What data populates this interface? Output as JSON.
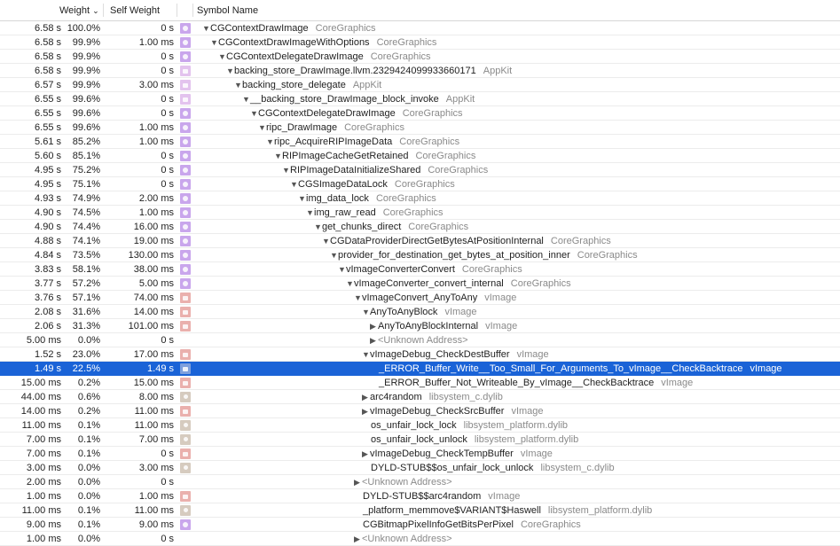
{
  "header": {
    "weight": "Weight",
    "self_weight": "Self Weight",
    "symbol_name": "Symbol Name",
    "sort_icon": "chevron-down-icon"
  },
  "colors": {
    "selection": "#1a63d7",
    "CoreGraphics": "#c9a6ec",
    "AppKit": "#e3c3ee",
    "vImage": "#eab0ad",
    "libsystem": "#d6cbbf"
  },
  "rows": [
    {
      "weight": "6.58 s",
      "percent": "100.0%",
      "self": "0 s",
      "icon": "cg",
      "level": 0,
      "disclosure": "open",
      "symbol": "CGContextDrawImage",
      "library": "CoreGraphics"
    },
    {
      "weight": "6.58 s",
      "percent": "99.9%",
      "self": "1.00 ms",
      "icon": "cg",
      "level": 1,
      "disclosure": "open",
      "symbol": "CGContextDrawImageWithOptions",
      "library": "CoreGraphics"
    },
    {
      "weight": "6.58 s",
      "percent": "99.9%",
      "self": "0 s",
      "icon": "cg",
      "level": 2,
      "disclosure": "open",
      "symbol": "CGContextDelegateDrawImage",
      "library": "CoreGraphics"
    },
    {
      "weight": "6.58 s",
      "percent": "99.9%",
      "self": "0 s",
      "icon": "ak",
      "level": 3,
      "disclosure": "open",
      "symbol": "backing_store_DrawImage.llvm.2329424099933660171",
      "library": "AppKit"
    },
    {
      "weight": "6.57 s",
      "percent": "99.9%",
      "self": "3.00 ms",
      "icon": "ak",
      "level": 4,
      "disclosure": "open",
      "symbol": "backing_store_delegate",
      "library": "AppKit"
    },
    {
      "weight": "6.55 s",
      "percent": "99.6%",
      "self": "0 s",
      "icon": "ak",
      "level": 5,
      "disclosure": "open",
      "symbol": "__backing_store_DrawImage_block_invoke",
      "library": "AppKit"
    },
    {
      "weight": "6.55 s",
      "percent": "99.6%",
      "self": "0 s",
      "icon": "cg",
      "level": 6,
      "disclosure": "open",
      "symbol": "CGContextDelegateDrawImage",
      "library": "CoreGraphics"
    },
    {
      "weight": "6.55 s",
      "percent": "99.6%",
      "self": "1.00 ms",
      "icon": "cg",
      "level": 7,
      "disclosure": "open",
      "symbol": "ripc_DrawImage",
      "library": "CoreGraphics"
    },
    {
      "weight": "5.61 s",
      "percent": "85.2%",
      "self": "1.00 ms",
      "icon": "cg",
      "level": 8,
      "disclosure": "open",
      "symbol": "ripc_AcquireRIPImageData",
      "library": "CoreGraphics"
    },
    {
      "weight": "5.60 s",
      "percent": "85.1%",
      "self": "0 s",
      "icon": "cg",
      "level": 9,
      "disclosure": "open",
      "symbol": "RIPImageCacheGetRetained",
      "library": "CoreGraphics"
    },
    {
      "weight": "4.95 s",
      "percent": "75.2%",
      "self": "0 s",
      "icon": "cg",
      "level": 10,
      "disclosure": "open",
      "symbol": "RIPImageDataInitializeShared",
      "library": "CoreGraphics"
    },
    {
      "weight": "4.95 s",
      "percent": "75.1%",
      "self": "0 s",
      "icon": "cg",
      "level": 11,
      "disclosure": "open",
      "symbol": "CGSImageDataLock",
      "library": "CoreGraphics"
    },
    {
      "weight": "4.93 s",
      "percent": "74.9%",
      "self": "2.00 ms",
      "icon": "cg",
      "level": 12,
      "disclosure": "open",
      "symbol": "img_data_lock",
      "library": "CoreGraphics"
    },
    {
      "weight": "4.90 s",
      "percent": "74.5%",
      "self": "1.00 ms",
      "icon": "cg",
      "level": 13,
      "disclosure": "open",
      "symbol": "img_raw_read",
      "library": "CoreGraphics"
    },
    {
      "weight": "4.90 s",
      "percent": "74.4%",
      "self": "16.00 ms",
      "icon": "cg",
      "level": 14,
      "disclosure": "open",
      "symbol": "get_chunks_direct",
      "library": "CoreGraphics"
    },
    {
      "weight": "4.88 s",
      "percent": "74.1%",
      "self": "19.00 ms",
      "icon": "cg",
      "level": 15,
      "disclosure": "open",
      "symbol": "CGDataProviderDirectGetBytesAtPositionInternal",
      "library": "CoreGraphics"
    },
    {
      "weight": "4.84 s",
      "percent": "73.5%",
      "self": "130.00 ms",
      "icon": "cg",
      "level": 16,
      "disclosure": "open",
      "symbol": "provider_for_destination_get_bytes_at_position_inner",
      "library": "CoreGraphics"
    },
    {
      "weight": "3.83 s",
      "percent": "58.1%",
      "self": "38.00 ms",
      "icon": "cg",
      "level": 17,
      "disclosure": "open",
      "symbol": "vImageConverterConvert",
      "library": "CoreGraphics"
    },
    {
      "weight": "3.77 s",
      "percent": "57.2%",
      "self": "5.00 ms",
      "icon": "cg",
      "level": 18,
      "disclosure": "open",
      "symbol": "vImageConverter_convert_internal",
      "library": "CoreGraphics"
    },
    {
      "weight": "3.76 s",
      "percent": "57.1%",
      "self": "74.00 ms",
      "icon": "vi",
      "level": 19,
      "disclosure": "open",
      "symbol": "vImageConvert_AnyToAny",
      "library": "vImage"
    },
    {
      "weight": "2.08 s",
      "percent": "31.6%",
      "self": "14.00 ms",
      "icon": "vi",
      "level": 20,
      "disclosure": "open",
      "symbol": "AnyToAnyBlock",
      "library": "vImage"
    },
    {
      "weight": "2.06 s",
      "percent": "31.3%",
      "self": "101.00 ms",
      "icon": "vi",
      "level": 21,
      "disclosure": "closed",
      "symbol": "AnyToAnyBlockInternal",
      "library": "vImage"
    },
    {
      "weight": "5.00 ms",
      "percent": "0.0%",
      "self": "0 s",
      "icon": "",
      "level": 21,
      "disclosure": "closed",
      "symbol": "<Unknown Address>",
      "library": ""
    },
    {
      "weight": "1.52 s",
      "percent": "23.0%",
      "self": "17.00 ms",
      "icon": "vi",
      "level": 20,
      "disclosure": "open",
      "symbol": "vImageDebug_CheckDestBuffer",
      "library": "vImage"
    },
    {
      "weight": "1.49 s",
      "percent": "22.5%",
      "self": "1.49 s",
      "icon": "vi",
      "level": 21,
      "disclosure": "none",
      "symbol": "_ERROR_Buffer_Write__Too_Small_For_Arguments_To_vImage__CheckBacktrace",
      "library": "vImage",
      "selected": true
    },
    {
      "weight": "15.00 ms",
      "percent": "0.2%",
      "self": "15.00 ms",
      "icon": "vi",
      "level": 21,
      "disclosure": "none",
      "symbol": "_ERROR_Buffer_Not_Writeable_By_vImage__CheckBacktrace",
      "library": "vImage"
    },
    {
      "weight": "44.00 ms",
      "percent": "0.6%",
      "self": "8.00 ms",
      "icon": "ls",
      "level": 20,
      "disclosure": "closed",
      "symbol": "arc4random",
      "library": "libsystem_c.dylib"
    },
    {
      "weight": "14.00 ms",
      "percent": "0.2%",
      "self": "11.00 ms",
      "icon": "vi",
      "level": 20,
      "disclosure": "closed",
      "symbol": "vImageDebug_CheckSrcBuffer",
      "library": "vImage"
    },
    {
      "weight": "11.00 ms",
      "percent": "0.1%",
      "self": "11.00 ms",
      "icon": "ls",
      "level": 20,
      "disclosure": "none",
      "symbol": "os_unfair_lock_lock",
      "library": "libsystem_platform.dylib"
    },
    {
      "weight": "7.00 ms",
      "percent": "0.1%",
      "self": "7.00 ms",
      "icon": "ls",
      "level": 20,
      "disclosure": "none",
      "symbol": "os_unfair_lock_unlock",
      "library": "libsystem_platform.dylib"
    },
    {
      "weight": "7.00 ms",
      "percent": "0.1%",
      "self": "0 s",
      "icon": "vi",
      "level": 20,
      "disclosure": "closed",
      "symbol": "vImageDebug_CheckTempBuffer",
      "library": "vImage"
    },
    {
      "weight": "3.00 ms",
      "percent": "0.0%",
      "self": "3.00 ms",
      "icon": "ls",
      "level": 20,
      "disclosure": "none",
      "symbol": "DYLD-STUB$$os_unfair_lock_unlock",
      "library": "libsystem_c.dylib"
    },
    {
      "weight": "2.00 ms",
      "percent": "0.0%",
      "self": "0 s",
      "icon": "",
      "level": 19,
      "disclosure": "closed",
      "symbol": "<Unknown Address>",
      "library": ""
    },
    {
      "weight": "1.00 ms",
      "percent": "0.0%",
      "self": "1.00 ms",
      "icon": "vi",
      "level": 19,
      "disclosure": "none",
      "symbol": "DYLD-STUB$$arc4random",
      "library": "vImage"
    },
    {
      "weight": "11.00 ms",
      "percent": "0.1%",
      "self": "11.00 ms",
      "icon": "ls",
      "level": 19,
      "disclosure": "none",
      "symbol": "_platform_memmove$VARIANT$Haswell",
      "library": "libsystem_platform.dylib"
    },
    {
      "weight": "9.00 ms",
      "percent": "0.1%",
      "self": "9.00 ms",
      "icon": "cg",
      "level": 19,
      "disclosure": "none",
      "symbol": "CGBitmapPixelInfoGetBitsPerPixel",
      "library": "CoreGraphics"
    },
    {
      "weight": "1.00 ms",
      "percent": "0.0%",
      "self": "0 s",
      "icon": "",
      "level": 19,
      "disclosure": "closed",
      "symbol": "<Unknown Address>",
      "library": ""
    }
  ]
}
